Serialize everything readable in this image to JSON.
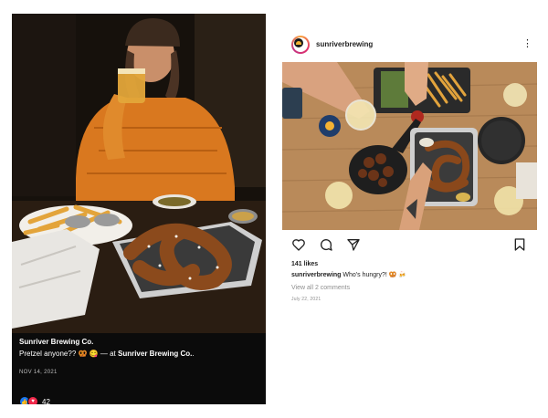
{
  "facebook_post": {
    "author": "Sunriver Brewing Co.",
    "text_before": "Pretzel anyone?? 🥨 😋 — at ",
    "place": "Sunriver Brewing Co.",
    "text_after": ".",
    "date": "NOV 14, 2021",
    "reaction_count": "42",
    "reaction_icons": [
      "like-icon",
      "love-icon"
    ],
    "colors": {
      "background": "#0b0b0b",
      "like": "#1877f2",
      "love": "#f0284a"
    }
  },
  "instagram_post": {
    "username": "sunriverbrewing",
    "more_icon": "more-options-icon",
    "likes": "141 likes",
    "caption_user": "sunriverbrewing",
    "caption_text": " Who's hungry?! 🥨 🍻",
    "comments_link": "View all 2 comments",
    "date": "July 22, 2021",
    "action_icons": [
      "heart-icon",
      "comment-icon",
      "share-icon",
      "bookmark-icon"
    ]
  }
}
